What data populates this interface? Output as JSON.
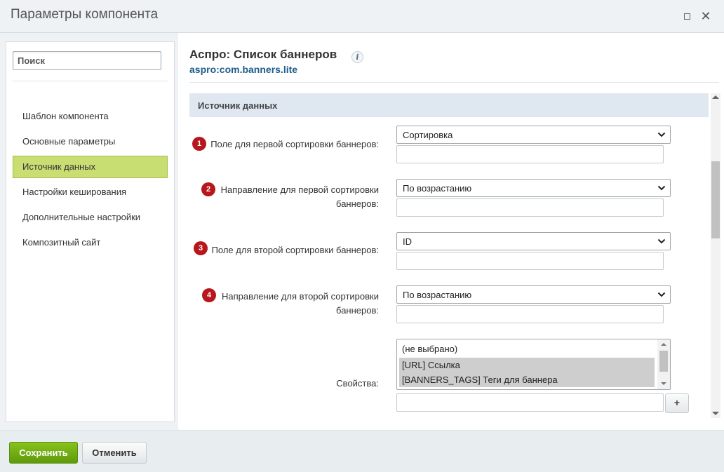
{
  "window": {
    "title": "Параметры компонента"
  },
  "sidebar": {
    "search_placeholder": "Поиск",
    "items": [
      {
        "label": "Шаблон компонента",
        "active": false
      },
      {
        "label": "Основные параметры",
        "active": false
      },
      {
        "label": "Источник данных",
        "active": true
      },
      {
        "label": "Настройки кеширования",
        "active": false
      },
      {
        "label": "Дополнительные настройки",
        "active": false
      },
      {
        "label": "Композитный сайт",
        "active": false
      }
    ]
  },
  "main": {
    "component_title": "Аспро: Список баннеров",
    "info_icon": "i",
    "component_code": "aspro:com.banners.lite",
    "section_title": "Источник данных",
    "fields": [
      {
        "badge": "1",
        "label_line1": "Поле для первой сортировки баннеров:",
        "label_line2": "",
        "value": "Сортировка"
      },
      {
        "badge": "2",
        "label_line1": "Направление для первой сортировки",
        "label_line2": "баннеров:",
        "value": "По возрастанию"
      },
      {
        "badge": "3",
        "label_line1": "Поле для второй сортировки баннеров:",
        "label_line2": "",
        "value": "ID"
      },
      {
        "badge": "4",
        "label_line1": "Направление для второй сортировки",
        "label_line2": "баннеров:",
        "value": "По возрастанию"
      }
    ],
    "properties": {
      "label": "Свойства:",
      "options": [
        {
          "text": "(не выбрано)",
          "selected": false
        },
        {
          "text": "[URL] Ссылка",
          "selected": true
        },
        {
          "text": "[BANNERS_TAGS] Теги для баннера",
          "selected": true
        }
      ],
      "add_label": "+"
    }
  },
  "footer": {
    "save_label": "Сохранить",
    "cancel_label": "Отменить"
  },
  "colors": {
    "accent_green": "#6fab13",
    "active_nav": "#c8dd72",
    "badge_red": "#b8161d",
    "code_blue": "#1f5c8a",
    "section_bar": "#dfe8f0"
  }
}
